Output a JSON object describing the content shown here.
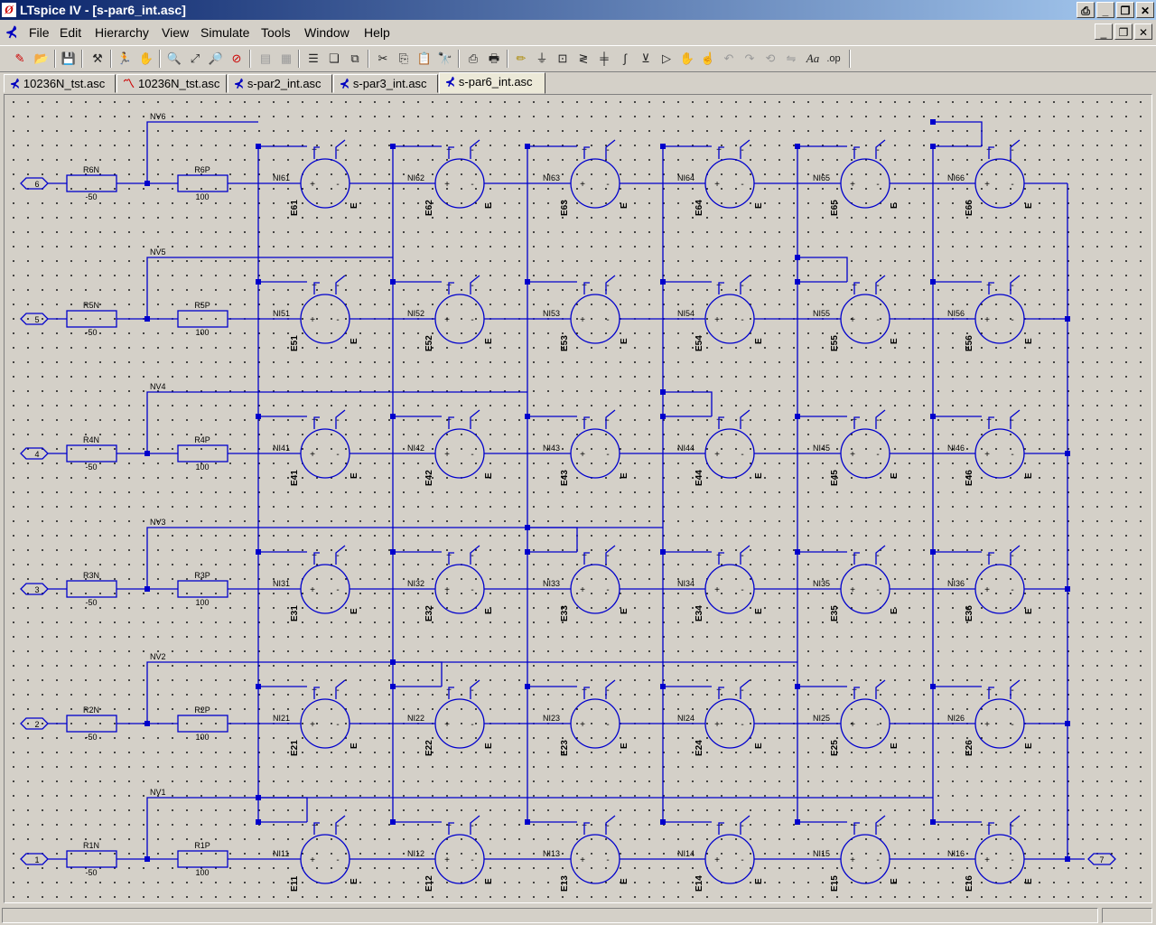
{
  "window": {
    "title": "LTspice IV - [s-par6_int.asc]",
    "app_icon": "ltspice-logo-icon"
  },
  "menu": {
    "items": [
      "File",
      "Edit",
      "Hierarchy",
      "View",
      "Simulate",
      "Tools",
      "Window",
      "Help"
    ]
  },
  "toolbar": {
    "icons": [
      "new-schematic-icon",
      "open-icon",
      "save-icon",
      "control-panel-icon",
      "run-icon",
      "halt-icon",
      "zoom-in-icon",
      "zoom-fit-icon",
      "zoom-out-icon",
      "zoom-cancel-icon",
      "tile-horizontal-icon",
      "tile-vertical-icon",
      "cascade-icon",
      "close-window-icon",
      "cut-icon",
      "copy-icon",
      "paste-icon",
      "find-icon",
      "print-preview-icon",
      "print-icon",
      "wire-icon",
      "ground-icon",
      "label-net-icon",
      "resistor-icon",
      "capacitor-icon",
      "inductor-icon",
      "diode-icon",
      "component-icon",
      "move-icon",
      "drag-icon",
      "undo-icon",
      "redo-icon",
      "rotate-icon",
      "mirror-icon",
      "text-icon",
      "spice-directive-icon"
    ]
  },
  "tabs": [
    {
      "label": "10236N_tst.asc",
      "icon": "schematic-icon",
      "active": false
    },
    {
      "label": "10236N_tst.asc",
      "icon": "waveform-icon",
      "active": false
    },
    {
      "label": "s-par2_int.asc",
      "icon": "schematic-icon",
      "active": false
    },
    {
      "label": "s-par3_int.asc",
      "icon": "schematic-icon",
      "active": false
    },
    {
      "label": "s-par6_int.asc",
      "icon": "schematic-icon",
      "active": true
    }
  ],
  "colors": {
    "wire": "#0000cc",
    "text": "#000000",
    "canvas": "#d4d0c8",
    "title_bar": "#0a246a"
  },
  "schematic": {
    "ports": [
      "6",
      "5",
      "4",
      "3",
      "2",
      "1"
    ],
    "output_port": "7",
    "rows": [
      {
        "port": "6",
        "rn": "R6N",
        "rn_val": "-50",
        "rp": "R6P",
        "rp_val": "100",
        "nv": "NV6",
        "ni": [
          "NI61",
          "NI62",
          "NI63",
          "NI64",
          "NI65",
          "NI66"
        ],
        "e": [
          "E61",
          "E62",
          "E63",
          "E64",
          "E65",
          "E66"
        ]
      },
      {
        "port": "5",
        "rn": "R5N",
        "rn_val": "-50",
        "rp": "R5P",
        "rp_val": "100",
        "nv": "NV5",
        "ni": [
          "NI51",
          "NI52",
          "NI53",
          "NI54",
          "NI55",
          "NI56"
        ],
        "e": [
          "E51",
          "E52",
          "E53",
          "E54",
          "E55",
          "E56"
        ]
      },
      {
        "port": "4",
        "rn": "R4N",
        "rn_val": "-50",
        "rp": "R4P",
        "rp_val": "100",
        "nv": "NV4",
        "ni": [
          "NI41",
          "NI42",
          "NI43",
          "NI44",
          "NI45",
          "NI46"
        ],
        "e": [
          "E41",
          "E42",
          "E43",
          "E44",
          "E45",
          "E46"
        ]
      },
      {
        "port": "3",
        "rn": "R3N",
        "rn_val": "-50",
        "rp": "R3P",
        "rp_val": "100",
        "nv": "NV3",
        "ni": [
          "NI31",
          "NI32",
          "NI33",
          "NI34",
          "NI35",
          "NI36"
        ],
        "e": [
          "E31",
          "E32",
          "E33",
          "E34",
          "E35",
          "E36"
        ]
      },
      {
        "port": "2",
        "rn": "R2N",
        "rn_val": "-50",
        "rp": "R2P",
        "rp_val": "100",
        "nv": "NV2",
        "ni": [
          "NI21",
          "NI22",
          "NI23",
          "NI24",
          "NI25",
          "NI26"
        ],
        "e": [
          "E21",
          "E22",
          "E23",
          "E24",
          "E25",
          "E26"
        ]
      },
      {
        "port": "1",
        "rn": "R1N",
        "rn_val": "-50",
        "rp": "R1P",
        "rp_val": "100",
        "nv": "NV1",
        "ni": [
          "NI11",
          "NI12",
          "NI13",
          "NI14",
          "NI15",
          "NI16"
        ],
        "e": [
          "E11",
          "E12",
          "E13",
          "E14",
          "E15",
          "E16"
        ]
      }
    ],
    "source_label": "E",
    "pin_plus": "+",
    "pin_minus": "-",
    "pin_plus_in": "+",
    "pin_minus_in": "-"
  }
}
